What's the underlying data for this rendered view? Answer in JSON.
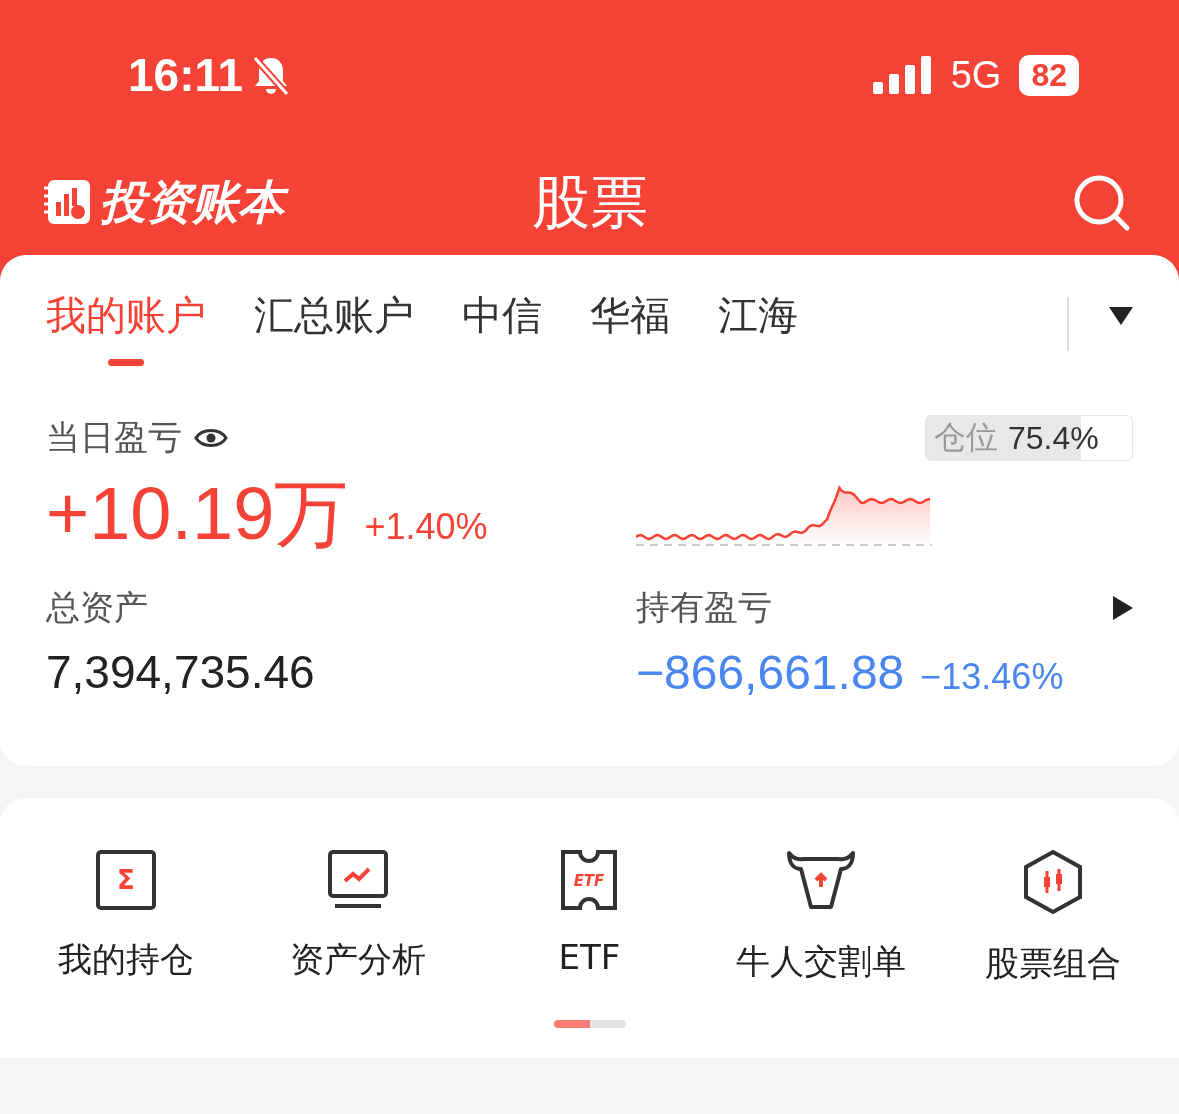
{
  "status_bar": {
    "time": "16:11",
    "muted": true,
    "network": "5G",
    "battery": "82"
  },
  "header": {
    "logo_text": "投资账本",
    "title": "股票"
  },
  "account_tabs": [
    {
      "label": "我的账户",
      "selected": true
    },
    {
      "label": "汇总账户",
      "selected": false
    },
    {
      "label": "中信",
      "selected": false
    },
    {
      "label": "华福",
      "selected": false
    },
    {
      "label": "江海",
      "selected": false
    }
  ],
  "summary": {
    "daily_label": "当日盈亏",
    "daily_value": "+10.19万",
    "daily_pct": "+1.40%",
    "position": {
      "label": "仓位",
      "value": "75.4%",
      "level": 0.754
    },
    "total_label": "总资产",
    "total_value": "7,394,735.46",
    "holding_label": "持有盈亏",
    "holding_value": "−866,661.88",
    "holding_pct": "−13.46%"
  },
  "shortcuts": [
    {
      "kind": "sigma",
      "glyph": "Σ",
      "label": "我的持仓"
    },
    {
      "kind": "monitor",
      "label": "资产分析"
    },
    {
      "kind": "ticket",
      "glyph": "ETF",
      "label": "ETF"
    },
    {
      "kind": "bull",
      "label": "牛人交割单"
    },
    {
      "kind": "hexagon",
      "label": "股票组合"
    }
  ],
  "pager": [
    {
      "selected": true
    },
    {
      "selected": false
    }
  ]
}
